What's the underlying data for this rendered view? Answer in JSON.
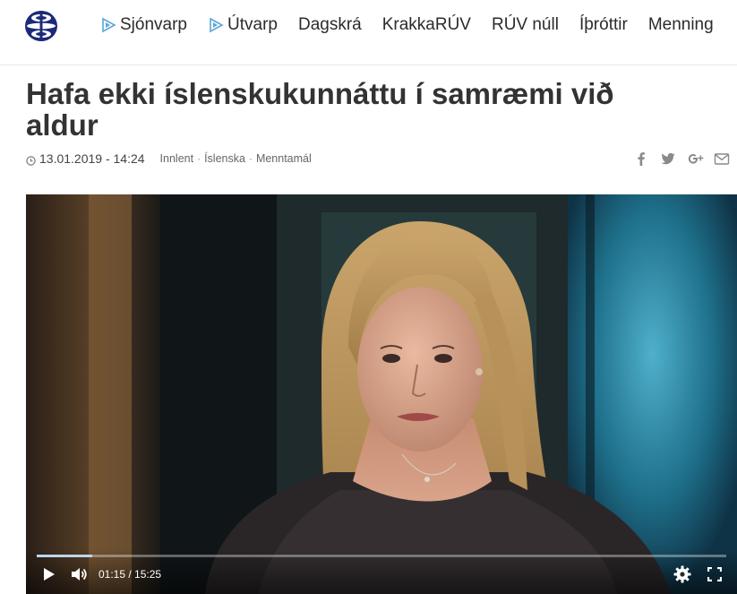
{
  "header": {
    "logo_icon": "ruv-logo-icon",
    "nav": [
      {
        "label": "Sjónvarp",
        "icon": "play-icon"
      },
      {
        "label": "Útvarp",
        "icon": "play-icon"
      },
      {
        "label": "Dagskrá"
      },
      {
        "label": "KrakkaRÚV"
      },
      {
        "label": "RÚV núll"
      },
      {
        "label": "Íþróttir"
      },
      {
        "label": "Menning"
      }
    ]
  },
  "article": {
    "title": "Hafa ekki íslenskukunnáttu í samræmi við aldur",
    "date": "13.01.2019 - 14:24",
    "tags": [
      "Innlent",
      "Íslenska",
      "Menntamál"
    ],
    "tag_separator": "·",
    "share_icons": [
      "facebook-icon",
      "twitter-icon",
      "google-plus-icon",
      "email-icon"
    ]
  },
  "video": {
    "current_time": "01:15",
    "time_separator": " / ",
    "duration": "15:25",
    "progress": 0.081,
    "accent_color": "#bcd6ee"
  }
}
